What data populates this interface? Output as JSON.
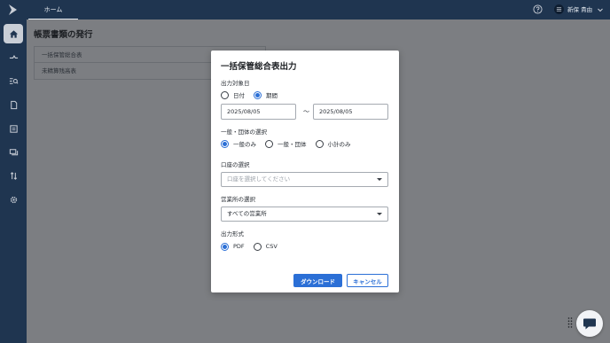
{
  "topbar": {
    "tab_home": "ホーム",
    "user_name": "新保 貴由"
  },
  "sidebar": {
    "items": [
      {
        "icon": "home-icon",
        "active": true
      },
      {
        "icon": "transfer-icon",
        "active": false
      },
      {
        "icon": "list-search-icon",
        "active": false
      },
      {
        "icon": "document-icon",
        "active": false
      },
      {
        "icon": "ledger-icon",
        "active": false
      },
      {
        "icon": "cards-icon",
        "active": false
      },
      {
        "icon": "sort-icon",
        "active": false
      },
      {
        "icon": "gear-icon",
        "active": false
      }
    ]
  },
  "page": {
    "title": "帳票書類の発行",
    "reports": [
      "一括保管総合表",
      "未精算残高表"
    ]
  },
  "modal": {
    "title": "一括保管総合表出力",
    "output_date": {
      "label": "出力対象日",
      "options": [
        "日付",
        "期間"
      ],
      "selected": "期間",
      "from": "2025/08/05",
      "separator": "～",
      "to": "2025/08/05"
    },
    "general_group": {
      "label": "一般・団体の選択",
      "options": [
        "一般のみ",
        "一般・団体",
        "小計のみ"
      ],
      "selected": "一般のみ"
    },
    "account": {
      "label": "口座の選択",
      "placeholder": "口座を選択してください"
    },
    "branch": {
      "label": "営業所の選択",
      "value": "すべての営業所"
    },
    "format": {
      "label": "出力形式",
      "options": [
        "PDF",
        "CSV"
      ],
      "selected": "PDF"
    },
    "download_label": "ダウンロード",
    "cancel_label": "キャンセル"
  },
  "colors": {
    "nav_bg": "#1f3550",
    "accent": "#2b6fd6",
    "overlay": "#7c7e82"
  }
}
